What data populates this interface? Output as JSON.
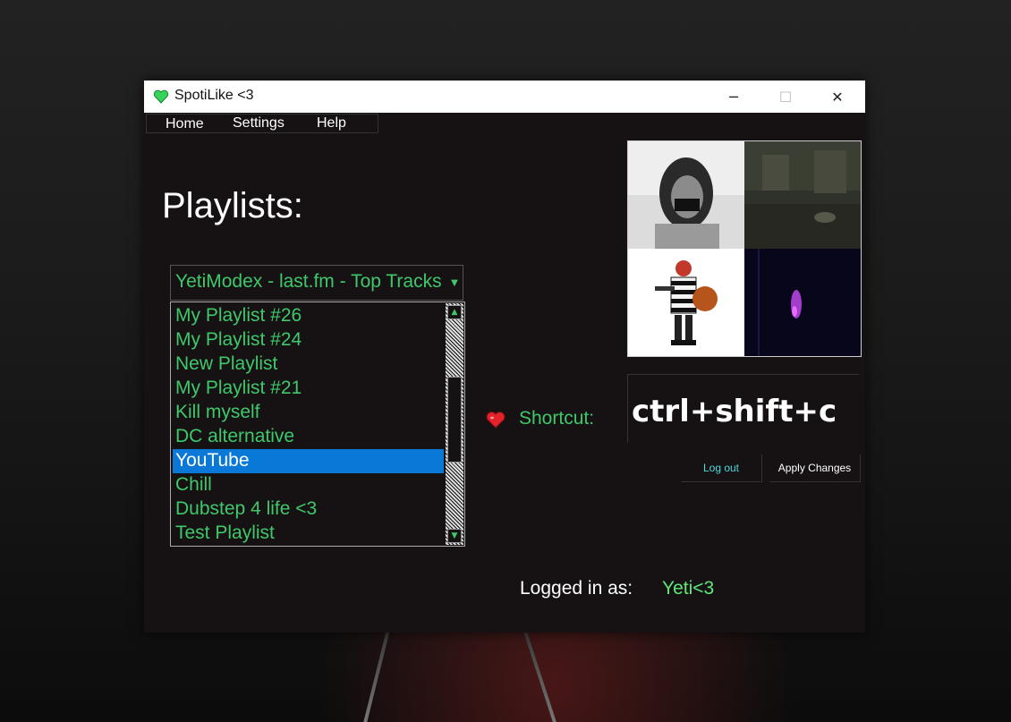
{
  "window": {
    "title": "SpotiLike <3",
    "controls": {
      "minimize": "─",
      "maximize": "☐",
      "close": "✕"
    }
  },
  "menu": {
    "items": [
      {
        "label": "Home"
      },
      {
        "label": "Settings"
      },
      {
        "label": "Help"
      }
    ]
  },
  "main": {
    "heading": "Playlists:",
    "source_select": {
      "value": "YetiModex - last.fm - Top Tracks"
    },
    "playlists": [
      {
        "label": "My Playlist #26",
        "selected": false
      },
      {
        "label": "My Playlist #24",
        "selected": false
      },
      {
        "label": "New Playlist",
        "selected": false
      },
      {
        "label": "My Playlist #21",
        "selected": false
      },
      {
        "label": "Kill myself",
        "selected": false
      },
      {
        "label": "DC alternative",
        "selected": false
      },
      {
        "label": "YouTube",
        "selected": true
      },
      {
        "label": "Chill",
        "selected": false
      },
      {
        "label": "Dubstep 4 life <3",
        "selected": false
      },
      {
        "label": "Test Playlist",
        "selected": false
      }
    ]
  },
  "shortcut": {
    "label": "Shortcut:",
    "value": "ctrl+shift+c"
  },
  "buttons": {
    "logout": "Log out",
    "apply": "Apply Changes"
  },
  "status": {
    "logged_in_label": "Logged in as:",
    "username": "Yeti<3"
  },
  "colors": {
    "accent_green": "#3ec86a",
    "selection_blue": "#0a78d7",
    "window_bg": "#161213",
    "logout_text": "#4fd6e0"
  }
}
